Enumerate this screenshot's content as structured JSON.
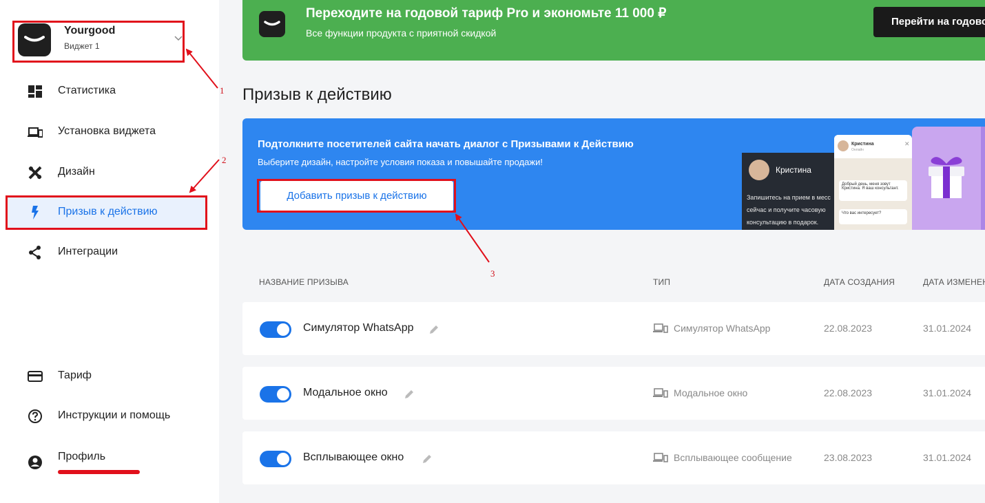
{
  "widget": {
    "brand": "Yourgood",
    "subtitle": "Виджет 1"
  },
  "sidebar": {
    "items": [
      {
        "label": "Статистика",
        "icon": "dashboard-icon"
      },
      {
        "label": "Установка виджета",
        "icon": "devices-icon"
      },
      {
        "label": "Дизайн",
        "icon": "design-tools-icon"
      },
      {
        "label": "Призыв к действию",
        "icon": "lightning-icon",
        "active": true
      },
      {
        "label": "Интеграции",
        "icon": "share-icon"
      }
    ],
    "bottom_items": [
      {
        "label": "Тариф",
        "icon": "credit-card-icon"
      },
      {
        "label": "Инструкции и помощь",
        "icon": "help-icon"
      },
      {
        "label": "Профиль",
        "icon": "account-icon"
      }
    ]
  },
  "promo": {
    "title": "Переходите на годовой тариф Pro и экономьте 11 000 ₽",
    "subtitle": "Все функции продукта с приятной скидкой",
    "button": "Перейти на годовой тариф"
  },
  "page": {
    "title": "Призыв к действию"
  },
  "banner": {
    "title": "Подтолкните посетителей сайта начать диалог с Призывами к Действию",
    "subtitle": "Выберите дизайн, настройте условия показа и повышайте продажи!",
    "button": "Добавить призыв к действию",
    "preview": {
      "name": "Кристина",
      "lines": [
        "Запишитесь на прием в месс",
        "сейчас и получите часовую",
        "консультацию в подарок."
      ],
      "chat_name": "Кристина",
      "chat_status": "Онлайн",
      "chat_msg1": "Добрый день, меня зовут Кристина. Я ваш консультант.",
      "chat_msg2": "Что вас интересует?"
    }
  },
  "table": {
    "headers": {
      "name": "НАЗВАНИЕ ПРИЗЫВА",
      "type": "ТИП",
      "created": "ДАТА СОЗДАНИЯ",
      "updated": "ДАТА ИЗМЕНЕНИЯ"
    },
    "rows": [
      {
        "name": "Симулятор WhatsApp",
        "type": "Симулятор WhatsApp",
        "created": "22.08.2023",
        "updated": "31.01.2024",
        "enabled": true
      },
      {
        "name": "Модальное окно",
        "type": "Модальное окно",
        "created": "22.08.2023",
        "updated": "31.01.2024",
        "enabled": true
      },
      {
        "name": "Всплывающее окно",
        "type": "Всплывающее сообщение",
        "created": "23.08.2023",
        "updated": "31.01.2024",
        "enabled": true
      }
    ]
  },
  "annotations": [
    "1",
    "2",
    "3"
  ],
  "colors": {
    "accent": "#1a73e8",
    "promo": "#4caf50",
    "banner": "#2e86f0",
    "annotation": "#e1101b"
  }
}
